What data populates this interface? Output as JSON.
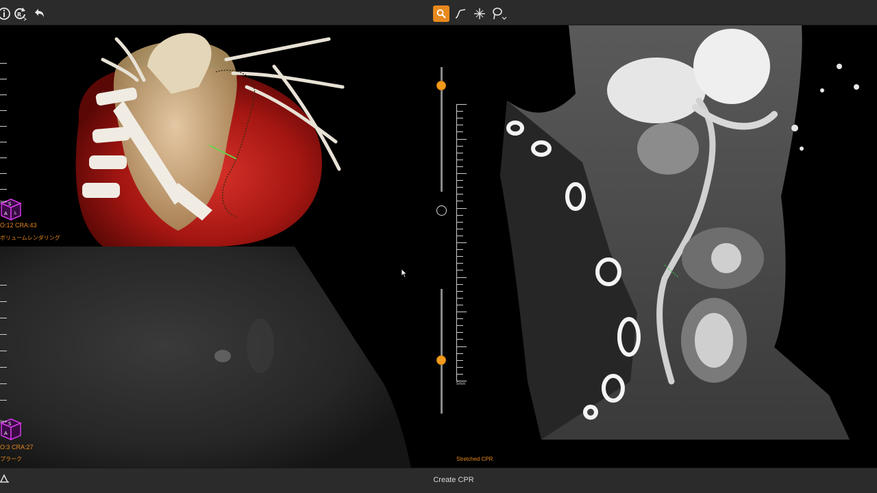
{
  "toolbar": {
    "left_icons": [
      "info-icon",
      "rotate-reset-icon",
      "undo-icon"
    ],
    "center_icons": [
      "zoom-search-icon",
      "curve-path-icon",
      "crosshair-icon",
      "lasso-icon"
    ],
    "active_tool": "zoom-search-icon"
  },
  "viewports": {
    "volume": {
      "angle_text": "O:12 CRA:43",
      "mode_text": "ボリュームレンダリング",
      "cube_letters": {
        "top": "S",
        "front": "A",
        "side": "L",
        "corner": "3mm"
      }
    },
    "axial": {
      "angle_text": "O:3 CRA:27",
      "mode_text": "プラーク",
      "cube_letters": {
        "top": "S",
        "front": "A",
        "corner": "3mm"
      }
    },
    "cpr": {
      "label": "Stretched CPR"
    }
  },
  "slab_controls": {
    "upper_slider_value": 0.15,
    "lower_slider_value": 0.57,
    "scale_unit": "5mm"
  },
  "bottom_bar": {
    "create_button_label": "Create CPR",
    "left_icon": "vessel-tool-icon"
  },
  "colors": {
    "accent": "#e8891d",
    "toolbar_bg": "#2b2b2b",
    "cube_magenta": "#b429c8",
    "vessel_red": "#b01818"
  }
}
